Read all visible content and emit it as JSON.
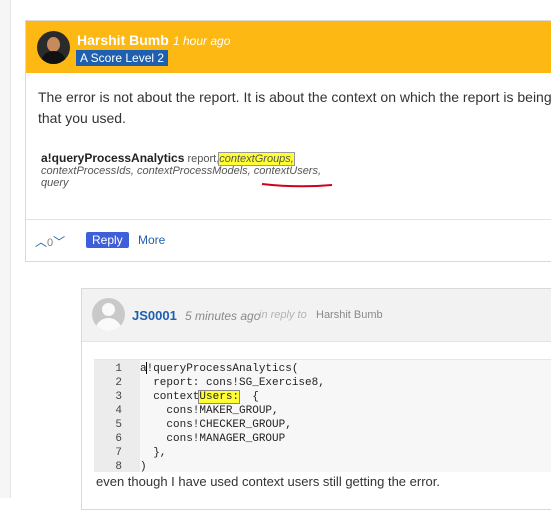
{
  "post1": {
    "author": "Harshit Bumb",
    "time": "1 hour ago",
    "badge": "A Score Level 2",
    "text_line1": "The error is not about the report. It is about the context on which the report is being",
    "text_line2": "that you used.",
    "snippet": {
      "function": "a!queryProcessAnalytics",
      "arg_report": "report,",
      "arg_context_groups": "contextGroups,",
      "arg_process_ids": "contextProcessIds,",
      "arg_process_models": "contextProcessModels,",
      "arg_context_users": "contextUsers,",
      "arg_query": "query"
    },
    "footer": {
      "vote_count": "0",
      "reply_label": "Reply",
      "more_label": "More"
    }
  },
  "post2": {
    "author": "JS0001",
    "time": "5 minutes ago",
    "in_reply_to_label": "in reply to",
    "in_reply_to_name": "Harshit Bumb",
    "code_lines": [
      {
        "n": "1",
        "prefix": "a",
        "highlight": "",
        "suffix": "!queryProcessAnalytics("
      },
      {
        "n": "2",
        "prefix": "  report: cons!SG_Exercise8,",
        "highlight": "",
        "suffix": ""
      },
      {
        "n": "3",
        "prefix": "  context",
        "highlight": "Users:",
        "suffix": "  {"
      },
      {
        "n": "4",
        "prefix": "    cons!MAKER_GROUP,",
        "highlight": "",
        "suffix": ""
      },
      {
        "n": "5",
        "prefix": "    cons!CHECKER_GROUP,",
        "highlight": "",
        "suffix": ""
      },
      {
        "n": "6",
        "prefix": "    cons!MANAGER_GROUP",
        "highlight": "",
        "suffix": ""
      },
      {
        "n": "7",
        "prefix": "  },",
        "highlight": "",
        "suffix": ""
      },
      {
        "n": "8",
        "prefix": ")",
        "highlight": "",
        "suffix": ""
      }
    ],
    "after_text": "even though I have used context users still getting the error."
  },
  "colors": {
    "header_yellow": "#fdb813",
    "badge_blue": "#1f5faf",
    "reply_button": "#3f5fd8",
    "highlight": "#ffff33",
    "underline_red": "#d0021b"
  },
  "icons": [
    "user-avatar-photo",
    "default-user-avatar",
    "upvote-chevron",
    "downvote-chevron"
  ]
}
